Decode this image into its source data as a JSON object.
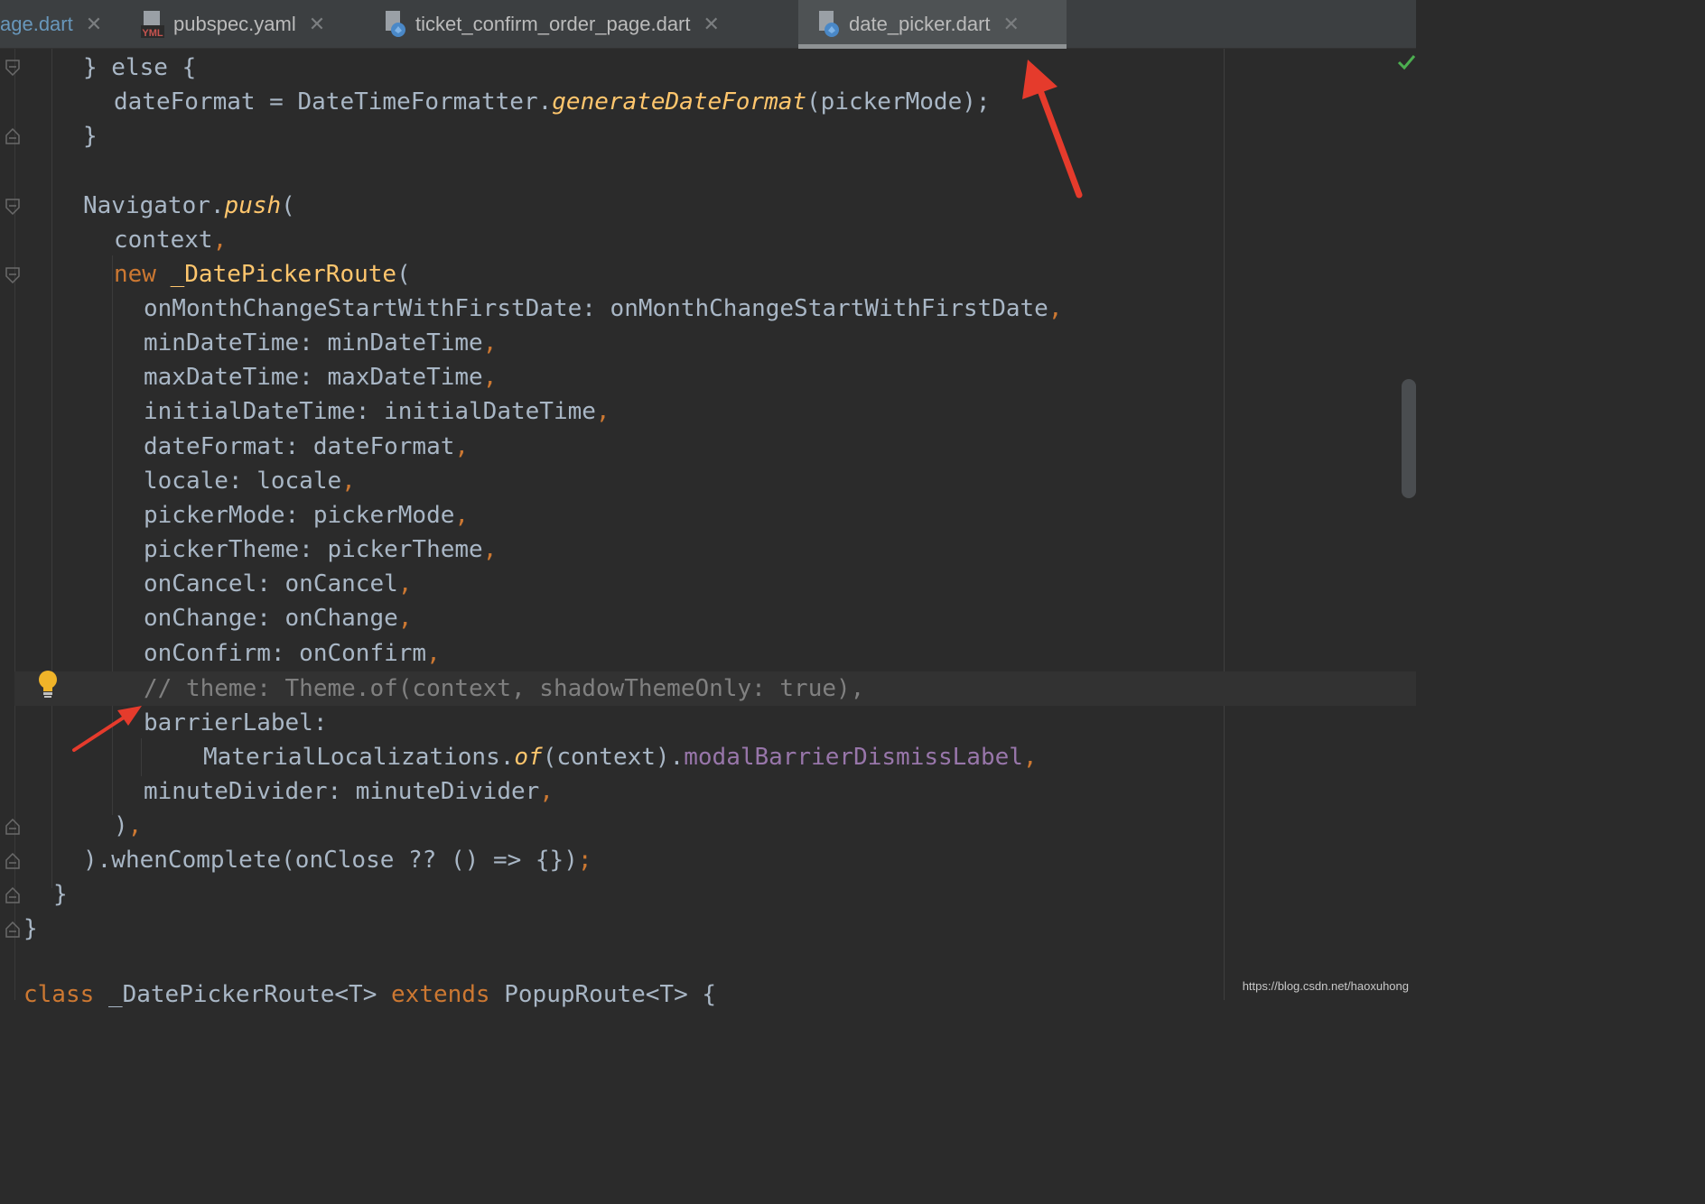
{
  "tabs": [
    {
      "label": "age.dart",
      "icon": "dart-file-icon"
    },
    {
      "label": "pubspec.yaml",
      "icon": "yaml-file-icon",
      "icon_text": "YML"
    },
    {
      "label": "ticket_confirm_order_page.dart",
      "icon": "dart-file-icon"
    },
    {
      "label": "date_picker.dart",
      "icon": "dart-file-icon",
      "active": true
    }
  ],
  "code_lines": [
    "} else {",
    "dateFormat = DateTimeFormatter.",
    "generateDateFormat",
    "(pickerMode);",
    "}",
    "Navigator.",
    "push",
    "(",
    "context",
    "new",
    "_DatePickerRoute",
    "onMonthChangeStartWithFirstDate: onMonthChangeStartWithFirstDate",
    "minDateTime: minDateTime",
    "maxDateTime: maxDateTime",
    "initialDateTime: initialDateTime",
    "dateFormat: dateFormat",
    "locale: locale",
    "pickerMode: pickerMode",
    "pickerTheme: pickerTheme",
    "onCancel: onCancel",
    "onChange: onChange",
    "onConfirm: onConfirm",
    "// theme: Theme.of(context, shadowThemeOnly: true),",
    "barrierLabel:",
    "MaterialLocalizations.",
    "of",
    "(context).",
    "modalBarrierDismissLabel",
    "minuteDivider: minuteDivider",
    ")",
    ").whenComplete(onClose ?? () => {})",
    "}",
    "}",
    "class",
    "_DatePickerRoute<T>",
    "extends",
    "PopupRoute<T> {"
  ],
  "watermark": "https://blog.csdn.net/haoxuhong",
  "colors": {
    "keyword": "#cc7832",
    "function": "#ffc66d",
    "identifier": "#a9b7c6",
    "property": "#9876aa",
    "comment": "#808080",
    "annotation_arrow": "#e53b2c"
  }
}
